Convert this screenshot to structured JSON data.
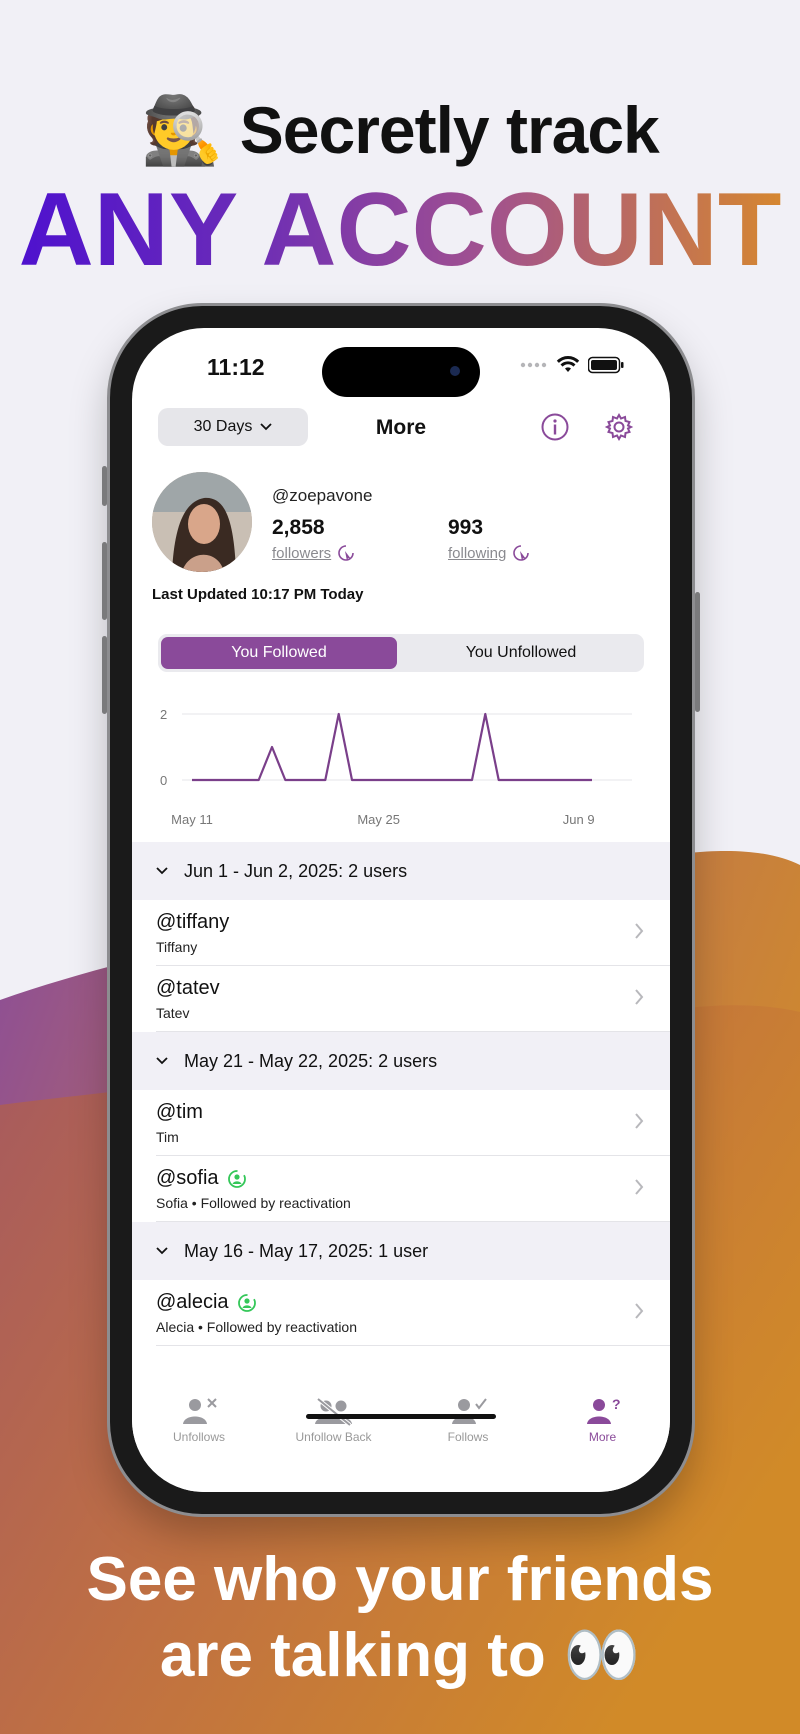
{
  "promo": {
    "spy_emoji": "🕵️",
    "headline_top": "Secretly track",
    "headline_big": "ANY ACCOUNT",
    "footer_line1": "See who your friends",
    "footer_line2": "are talking to",
    "eyes_emoji": "👀",
    "gradient_colors": [
      "#4c0fd0",
      "#a05090",
      "#d98a2a"
    ]
  },
  "status_bar": {
    "time": "11:12"
  },
  "nav": {
    "filter_label": "30 Days",
    "title": "More"
  },
  "profile": {
    "username": "@zoepavone",
    "followers_count": "2,858",
    "followers_label": "followers",
    "following_count": "993",
    "following_label": "following",
    "last_updated": "Last Updated 10:17 PM Today"
  },
  "segment": {
    "active": "You Followed",
    "inactive": "You Unfollowed"
  },
  "chart_data": {
    "type": "line",
    "x": [
      "May 11",
      "May 12",
      "May 13",
      "May 14",
      "May 15",
      "May 16",
      "May 17",
      "May 18",
      "May 19",
      "May 20",
      "May 21",
      "May 22",
      "May 23",
      "May 24",
      "May 25",
      "May 26",
      "May 27",
      "May 28",
      "May 29",
      "May 30",
      "May 31",
      "Jun 1",
      "Jun 2",
      "Jun 3",
      "Jun 4",
      "Jun 5",
      "Jun 6",
      "Jun 7",
      "Jun 8",
      "Jun 9",
      "Jun 10"
    ],
    "y": [
      0,
      0,
      0,
      0,
      0,
      0,
      1,
      0,
      0,
      0,
      0,
      2,
      0,
      0,
      0,
      0,
      0,
      0,
      0,
      0,
      0,
      0,
      2,
      0,
      0,
      0,
      0,
      0,
      0,
      0,
      0
    ],
    "x_ticks": [
      "May 11",
      "May 25",
      "Jun 9"
    ],
    "y_ticks": [
      "2",
      "0"
    ],
    "ylim": [
      0,
      2
    ],
    "color": "#7a3f8a"
  },
  "groups": [
    {
      "header": "Jun 1 - Jun 2, 2025: 2 users",
      "rows": [
        {
          "handle": "@tiffany",
          "sub": "Tiffany"
        },
        {
          "handle": "@tatev",
          "sub": "Tatev"
        }
      ]
    },
    {
      "header": "May 21 - May 22, 2025: 2 users",
      "rows": [
        {
          "handle": "@tim",
          "sub": "Tim"
        },
        {
          "handle": "@sofia",
          "sub": "Sofia • Followed by reactivation"
        }
      ]
    },
    {
      "header": "May 16 - May 17, 2025: 1 user",
      "rows": [
        {
          "handle": "@alecia",
          "sub": "Alecia • Followed by reactivation"
        }
      ]
    }
  ],
  "tabs": [
    {
      "label": "Unfollows",
      "icon": "person-x-icon"
    },
    {
      "label": "Unfollow Back",
      "icon": "people-slash-icon"
    },
    {
      "label": "Follows",
      "icon": "person-check-icon"
    },
    {
      "label": "More",
      "icon": "person-question-icon"
    }
  ],
  "colors": {
    "accent": "#8a4a9a",
    "reactivation_badge": "#34c759"
  }
}
